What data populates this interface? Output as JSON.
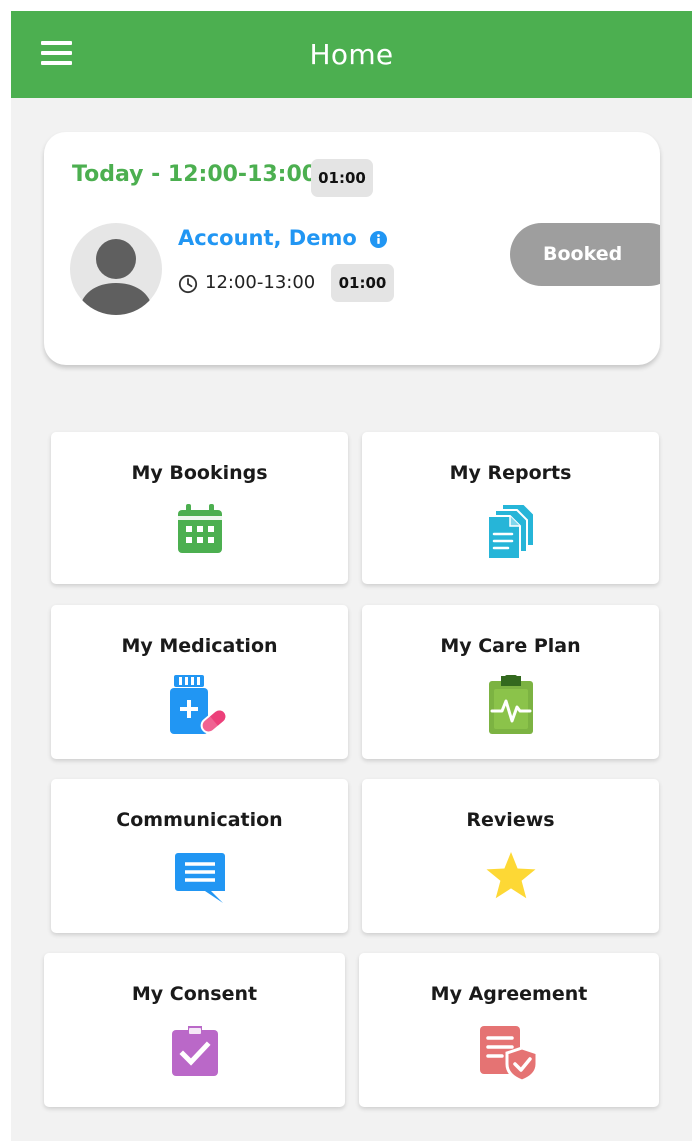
{
  "appbar": {
    "title": "Home",
    "color": "#4caf50"
  },
  "appointment": {
    "date_label": "Today - 12:00-13:00",
    "date_duration": "01:00",
    "client_name": "Account, Demo",
    "time": "12:00-13:00",
    "time_duration": "01:00",
    "status": "Booked"
  },
  "tiles": [
    {
      "label": "My Bookings",
      "icon": "calendar-icon",
      "color": "#4caf50"
    },
    {
      "label": "My Reports",
      "icon": "documents-icon",
      "color": "#26b5d8"
    },
    {
      "label": "My Medication",
      "icon": "medication-icon",
      "color": "#2196f3"
    },
    {
      "label": "My Care Plan",
      "icon": "clipboard-pulse-icon",
      "color": "#7cb342"
    },
    {
      "label": "Communication",
      "icon": "chat-icon",
      "color": "#2196f3"
    },
    {
      "label": "Reviews",
      "icon": "star-icon",
      "color": "#fdd835"
    },
    {
      "label": "My Consent",
      "icon": "clipboard-check-icon",
      "color": "#ba68c8"
    },
    {
      "label": "My Agreement",
      "icon": "agreement-shield-icon",
      "color": "#e57373"
    }
  ]
}
